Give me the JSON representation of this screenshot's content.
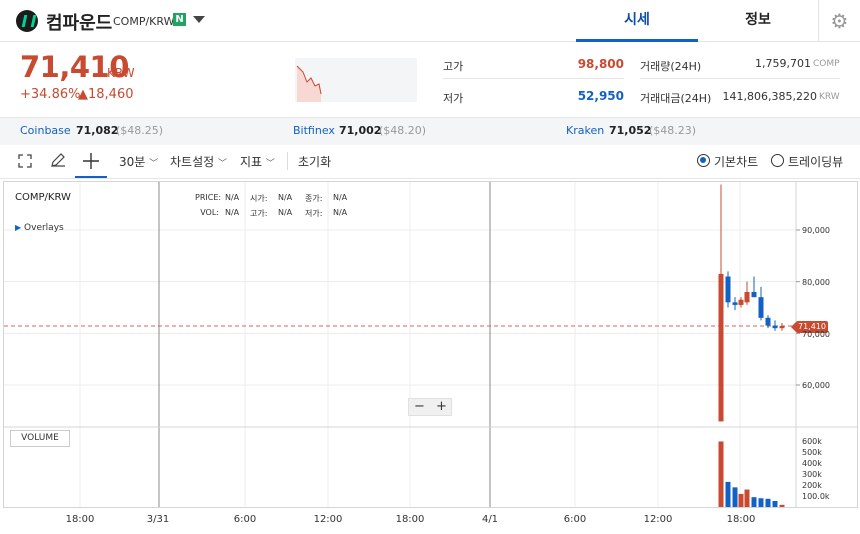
{
  "header": {
    "coin_name": "컴파운드",
    "pair": "COMP/KRW",
    "badge": "N",
    "tabs": [
      "시세",
      "정보"
    ],
    "active_tab": "시세",
    "settings_icon": "gear-icon"
  },
  "price": {
    "current": "71,410",
    "unit": "KRW",
    "change_rate": "+34.86%",
    "change_amount": "▲18,460"
  },
  "stats": {
    "high_label": "고가",
    "high": "98,800",
    "low_label": "저가",
    "low": "52,950",
    "volume_label": "거래량(24H)",
    "volume": "1,759,701",
    "volume_unit": "COMP",
    "value_label": "거래대금(24H)",
    "value": "141,806,385,220",
    "value_unit": "KRW"
  },
  "exchanges": [
    {
      "name": "Coinbase",
      "price": "71,082",
      "usd": "($48.25)"
    },
    {
      "name": "Bitfinex",
      "price": "71,002",
      "usd": "($48.20)"
    },
    {
      "name": "Kraken",
      "price": "71,052",
      "usd": "($48.23)"
    }
  ],
  "toolbar": {
    "interval": "30분",
    "chart_settings": "차트설정",
    "indicators": "지표",
    "reset": "초기화",
    "basic_chart": "기본차트",
    "trading_view": "트레이딩뷰",
    "selected_view": "기본차트"
  },
  "chart": {
    "symbol": "COMP/KRW",
    "overlays": "Overlays",
    "price_label": "PRICE:",
    "price_val": "N/A",
    "open_label": "시가:",
    "open_val": "N/A",
    "close_label": "종가:",
    "close_val": "N/A",
    "vol_label": "VOL:",
    "vol_val": "N/A",
    "high_label": "고가:",
    "high_val": "N/A",
    "low_label": "저가:",
    "low_val": "N/A",
    "current_tag": "71,410",
    "volume_button": "VOLUME",
    "zoom_out": "−",
    "zoom_in": "+",
    "colors": {
      "up": "#c84a31",
      "down": "#1261c4"
    }
  },
  "chart_data": {
    "type": "candlestick",
    "x_ticks": [
      "18:00",
      "3/31",
      "6:00",
      "12:00",
      "18:00",
      "4/1",
      "6:00",
      "12:00",
      "18:00"
    ],
    "y_ticks": [
      "90,000",
      "80,000",
      "70,000",
      "60,000"
    ],
    "volume_ticks": [
      "600k",
      "500k",
      "400k",
      "300k",
      "200k",
      "100.0k"
    ],
    "ylim": [
      50000,
      100000
    ],
    "volume_ylim": [
      0,
      650000
    ],
    "current_price": 71410,
    "candles": [
      {
        "open": 52950,
        "high": 98800,
        "low": 52950,
        "close": 81500
      },
      {
        "open": 81000,
        "high": 82000,
        "low": 75000,
        "close": 76000
      },
      {
        "open": 76000,
        "high": 77000,
        "low": 74500,
        "close": 75500
      },
      {
        "open": 75500,
        "high": 77000,
        "low": 75000,
        "close": 76500
      },
      {
        "open": 76000,
        "high": 80000,
        "low": 75500,
        "close": 78000
      },
      {
        "open": 78000,
        "high": 81000,
        "low": 77000,
        "close": 77000
      },
      {
        "open": 77000,
        "high": 79000,
        "low": 72500,
        "close": 73000
      },
      {
        "open": 73000,
        "high": 73500,
        "low": 71000,
        "close": 71500
      },
      {
        "open": 71500,
        "high": 72500,
        "low": 70500,
        "close": 71000
      },
      {
        "open": 71000,
        "high": 72000,
        "low": 70500,
        "close": 71410
      }
    ],
    "volumes": [
      600000,
      230000,
      180000,
      120000,
      160000,
      90000,
      80000,
      75000,
      55000,
      20000
    ]
  }
}
